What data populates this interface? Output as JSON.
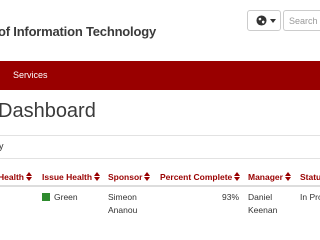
{
  "header": {
    "brand": "of Information Technology",
    "search_placeholder": "Search t"
  },
  "nav": {
    "items": [
      {
        "label": "Services"
      }
    ]
  },
  "page": {
    "title": "Dashboard",
    "subtitle": "y"
  },
  "table": {
    "columns": [
      "Health",
      "Issue Health",
      "Sponsor",
      "Percent Complete",
      "Manager",
      "Status"
    ],
    "rows": [
      {
        "issue_health": "Green",
        "sponsor": [
          "Simeon",
          "Ananou"
        ],
        "percent_complete": "93%",
        "manager": [
          "Daniel",
          "Keenan"
        ],
        "status": "In Pro"
      }
    ]
  },
  "colors": {
    "brand_red": "#990000",
    "health_green": "#2e8b2e"
  },
  "icons": {
    "language": "globe-icon",
    "sort": "sort-icon"
  }
}
